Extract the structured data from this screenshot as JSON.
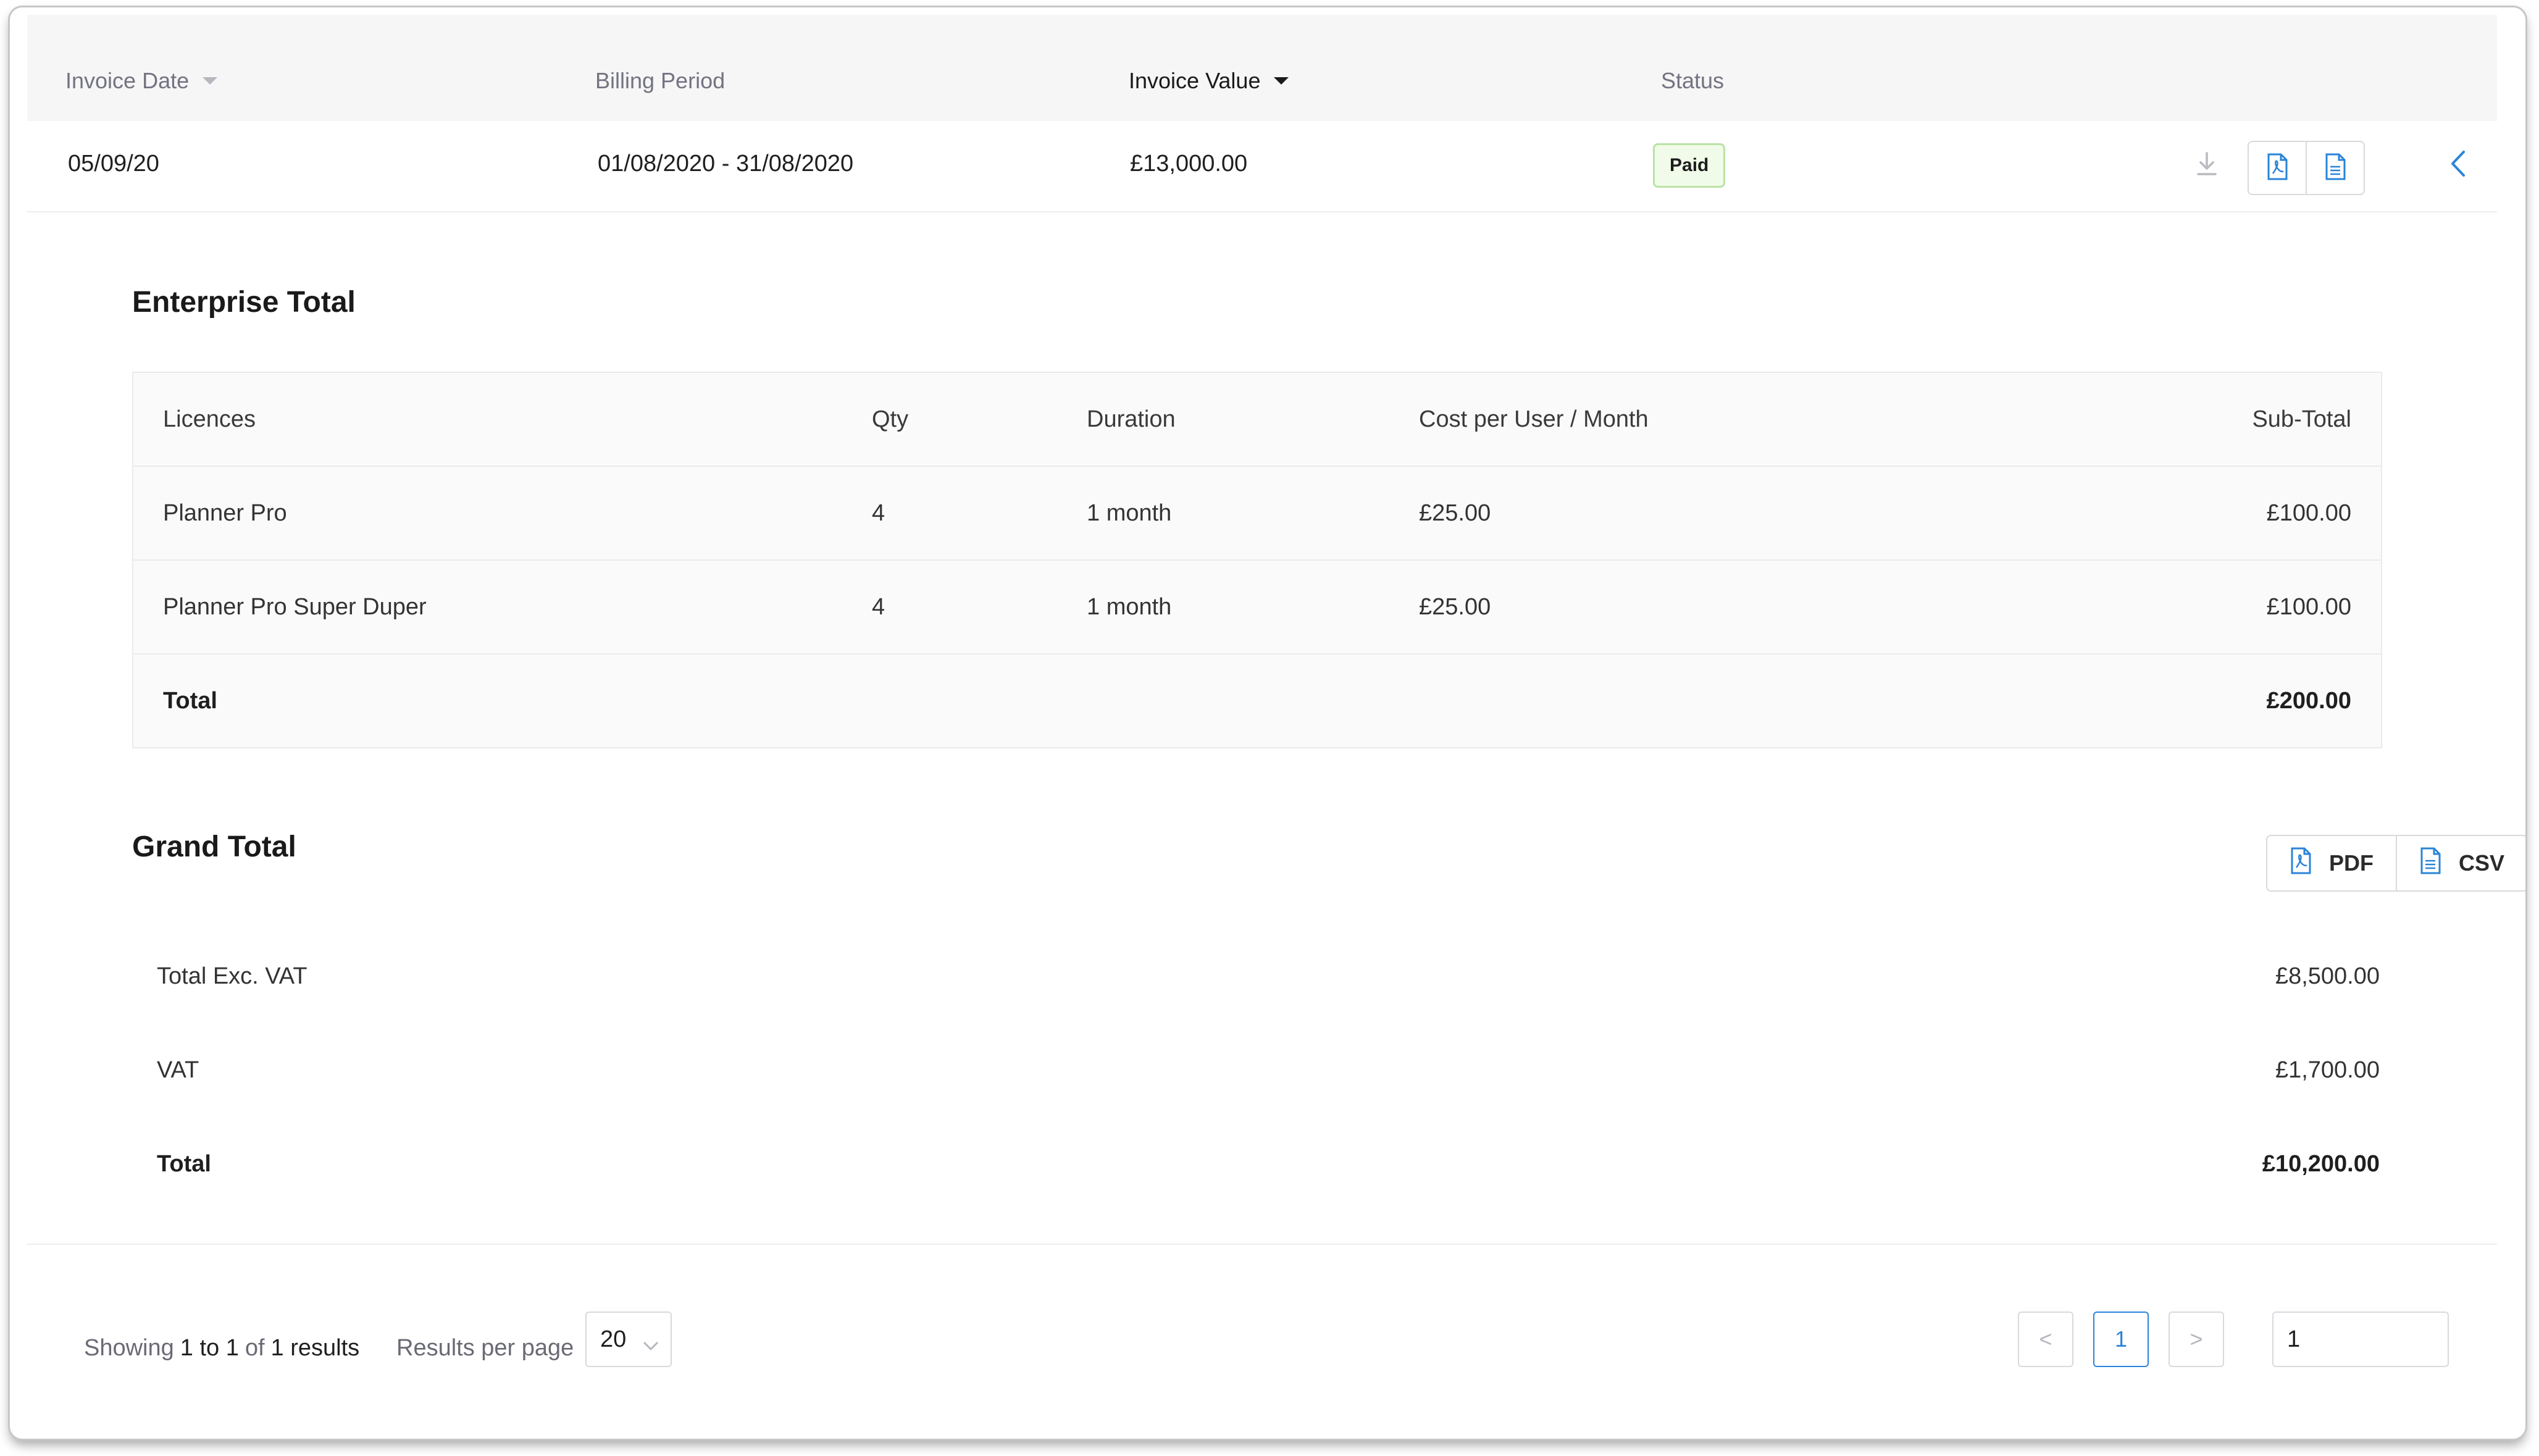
{
  "columns": {
    "invoice_date": "Invoice Date",
    "billing_period": "Billing Period",
    "invoice_value": "Invoice Value",
    "status": "Status"
  },
  "invoice": {
    "date": "05/09/20",
    "billing_period": "01/08/2020 - 31/08/2020",
    "value": "£13,000.00",
    "status": "Paid"
  },
  "enterprise": {
    "title": "Enterprise Total",
    "headers": {
      "licences": "Licences",
      "qty": "Qty",
      "duration": "Duration",
      "cost": "Cost per User / Month",
      "subtotal": "Sub-Total"
    },
    "rows": [
      {
        "licence": "Planner Pro",
        "qty": "4",
        "duration": "1 month",
        "cost": "£25.00",
        "subtotal": "£100.00"
      },
      {
        "licence": "Planner Pro Super Duper",
        "qty": "4",
        "duration": "1 month",
        "cost": "£25.00",
        "subtotal": "£100.00"
      }
    ],
    "total_label": "Total",
    "total_value": "£200.00"
  },
  "grand_total": {
    "title": "Grand Total",
    "pdf_label": "PDF",
    "csv_label": "CSV",
    "rows": [
      {
        "label": "Total Exc. VAT",
        "value": "£8,500.00"
      },
      {
        "label": "VAT",
        "value": "£1,700.00"
      },
      {
        "label": "Total",
        "value": "£10,200.00"
      }
    ]
  },
  "footer": {
    "showing": "Showing",
    "range": "1 to 1",
    "of": "of",
    "count": "1 results",
    "per_page_label": "Results per page",
    "per_page_value": "20",
    "prev": "<",
    "current_page": "1",
    "next": ">",
    "page_input_value": "1"
  },
  "colors": {
    "accent": "#2a84d8",
    "paid_bg": "#f1fbe9",
    "paid_border": "#b9e3a5"
  },
  "icons": {
    "download": "download-icon",
    "pdf": "pdf-file-icon",
    "csv": "csv-file-icon",
    "collapse": "chevron-left-icon"
  }
}
